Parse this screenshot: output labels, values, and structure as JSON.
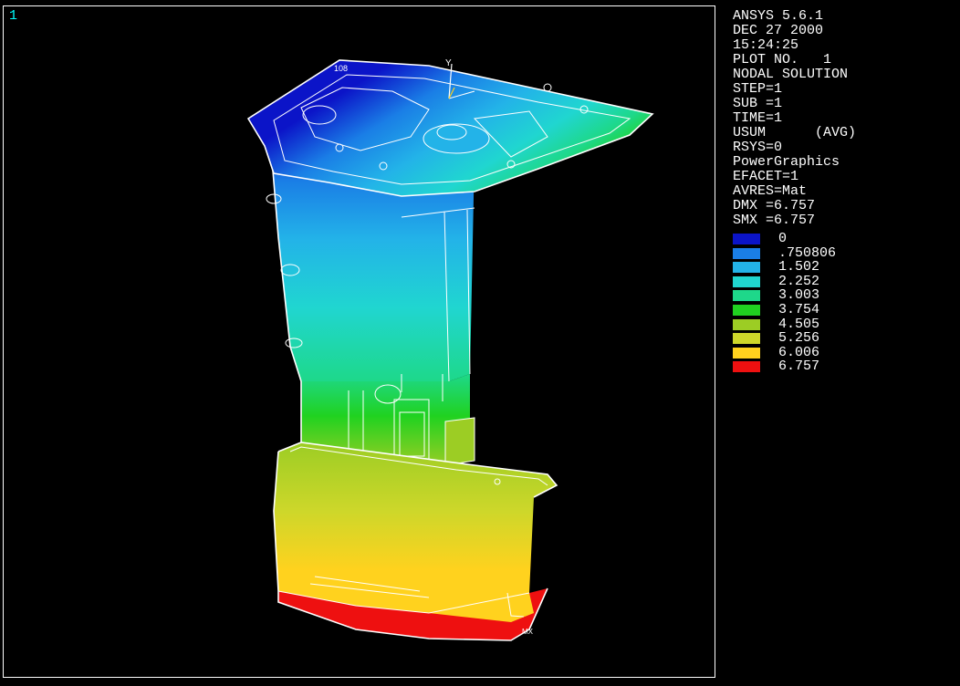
{
  "window": {
    "number": "1"
  },
  "info": {
    "lines": [
      "ANSYS 5.6.1",
      "DEC 27 2000",
      "15:24:25",
      "PLOT NO.   1",
      "NODAL SOLUTION",
      "STEP=1",
      "SUB =1",
      "TIME=1",
      "USUM      (AVG)",
      "RSYS=0",
      "PowerGraphics",
      "EFACET=1",
      "AVRES=Mat",
      "DMX =6.757",
      "SMX =6.757"
    ]
  },
  "legend": {
    "items": [
      {
        "label": "0",
        "color": "#0b14c8"
      },
      {
        "label": ".750806",
        "color": "#1a7ee6"
      },
      {
        "label": "1.502",
        "color": "#23b3e8"
      },
      {
        "label": "2.252",
        "color": "#20d6d0"
      },
      {
        "label": "3.003",
        "color": "#1ed88a"
      },
      {
        "label": "3.754",
        "color": "#20d220"
      },
      {
        "label": "4.505",
        "color": "#9ccd24"
      },
      {
        "label": "5.256",
        "color": "#cdd72a"
      },
      {
        "label": "6.006",
        "color": "#ffd21e"
      },
      {
        "label": "6.757",
        "color": "#ee1010"
      }
    ]
  },
  "model": {
    "labels": {
      "top_node": "108",
      "axis": "Y",
      "bottom_tag": "MX"
    },
    "colors": {
      "blue_dark": "#0b14c8",
      "blue": "#1a7ee6",
      "cyan": "#23b3e8",
      "teal": "#20d6d0",
      "green_teal": "#1ed88a",
      "green": "#20d220",
      "yellow_green": "#9ccd24",
      "olive_yellow": "#cdd72a",
      "yellow": "#ffd21e",
      "red": "#ee1010"
    }
  }
}
